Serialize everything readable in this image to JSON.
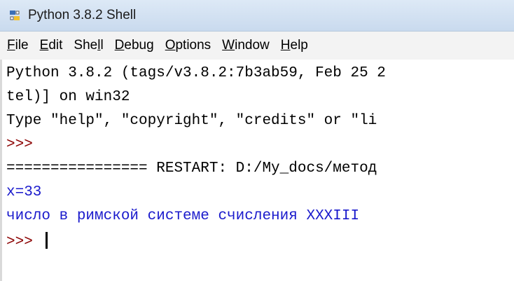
{
  "window": {
    "title": "Python 3.8.2 Shell",
    "icon": "python-idle-icon"
  },
  "menu": [
    {
      "underlined": "F",
      "rest": "ile"
    },
    {
      "underlined": "E",
      "rest": "dit"
    },
    {
      "pre": "She",
      "underlined": "l",
      "rest": "l"
    },
    {
      "underlined": "D",
      "rest": "ebug"
    },
    {
      "underlined": "O",
      "rest": "ptions"
    },
    {
      "underlined": "W",
      "rest": "indow"
    },
    {
      "underlined": "H",
      "rest": "elp"
    }
  ],
  "shell": {
    "lines": [
      "Python 3.8.2 (tags/v3.8.2:7b3ab59, Feb 25 2",
      "tel)] on win32",
      "Type \"help\", \"copyright\", \"credits\" or \"li",
      ">>>",
      "================ RESTART: D:/My_docs/метод",
      "x=33",
      "число в римской системе счисления XXXIII",
      ">>> "
    ]
  },
  "colors": {
    "prompt": "#8b0000",
    "program_output": "#1a1acc",
    "normal_text": "#000000"
  }
}
